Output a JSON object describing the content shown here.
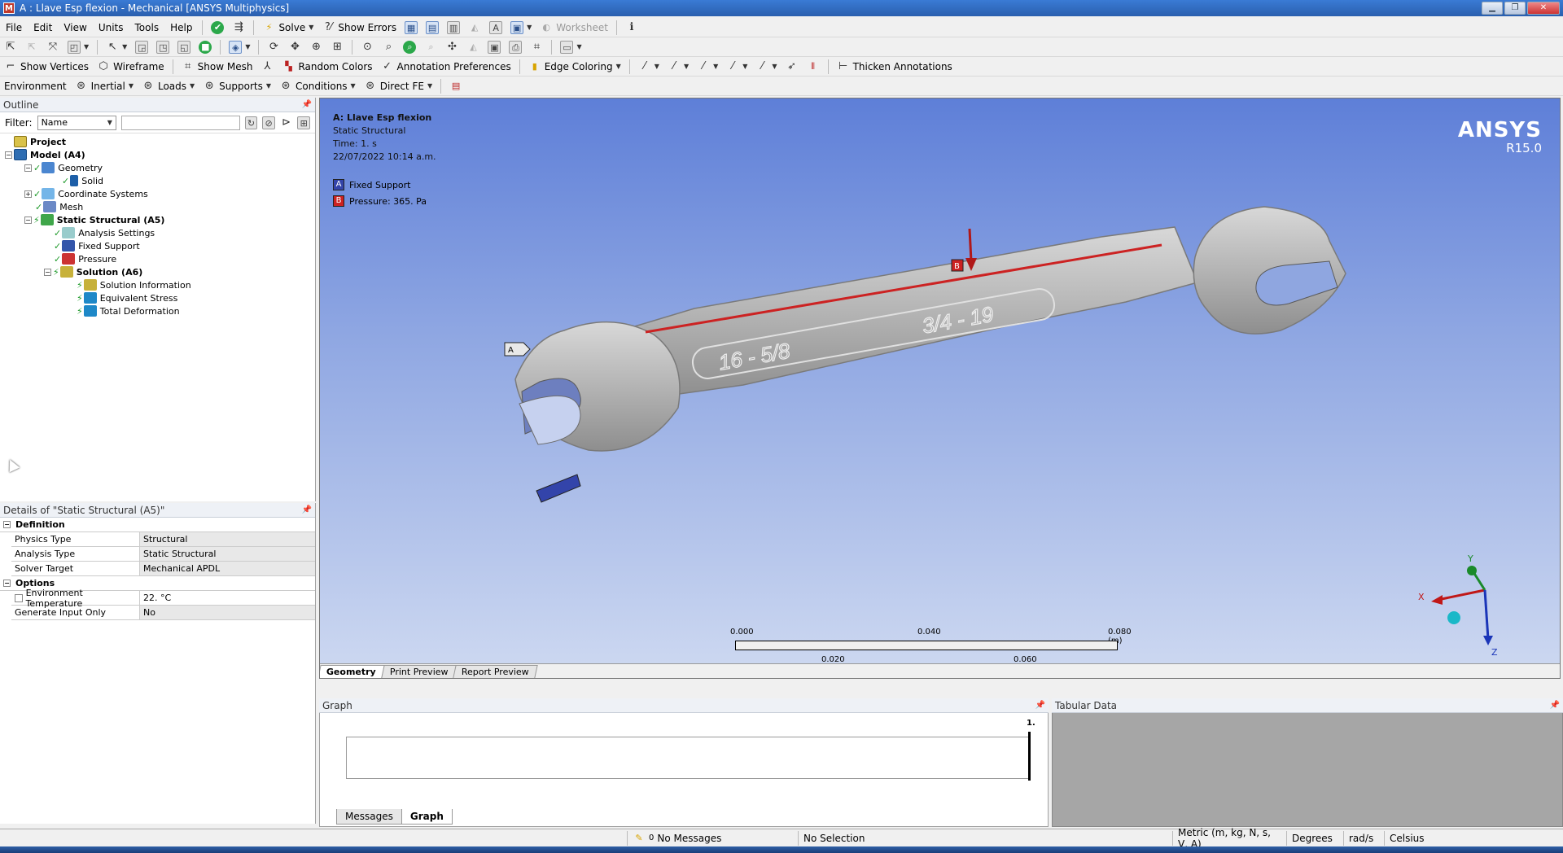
{
  "window": {
    "title": "A : Llave Esp flexion - Mechanical [ANSYS Multiphysics]",
    "app_icon_letter": "M"
  },
  "menubar": {
    "items": [
      "File",
      "Edit",
      "View",
      "Units",
      "Tools",
      "Help"
    ],
    "solve_label": "Solve",
    "show_errors_label": "Show Errors",
    "worksheet_label": "Worksheet"
  },
  "toolbar3": {
    "show_vertices": "Show Vertices",
    "wireframe": "Wireframe",
    "show_mesh": "Show Mesh",
    "random_colors": "Random Colors",
    "annotation_preferences": "Annotation Preferences",
    "edge_coloring": "Edge Coloring",
    "thicken_annotations": "Thicken Annotations"
  },
  "toolbar4": {
    "environment": "Environment",
    "inertial": "Inertial",
    "loads": "Loads",
    "supports": "Supports",
    "conditions": "Conditions",
    "direct_fe": "Direct FE"
  },
  "outline": {
    "header": "Outline",
    "filter_label": "Filter:",
    "filter_value": "Name",
    "tree": {
      "project": "Project",
      "model": "Model (A4)",
      "geometry": "Geometry",
      "solid": "Solid",
      "coordinate_systems": "Coordinate Systems",
      "mesh": "Mesh",
      "static_structural": "Static Structural (A5)",
      "analysis_settings": "Analysis Settings",
      "fixed_support": "Fixed Support",
      "pressure": "Pressure",
      "solution": "Solution (A6)",
      "solution_information": "Solution Information",
      "equivalent_stress": "Equivalent Stress",
      "total_deformation": "Total Deformation"
    }
  },
  "details": {
    "header": "Details of \"Static Structural (A5)\"",
    "definition_label": "Definition",
    "options_label": "Options",
    "physics_type_k": "Physics Type",
    "physics_type_v": "Structural",
    "analysis_type_k": "Analysis Type",
    "analysis_type_v": "Static Structural",
    "solver_target_k": "Solver Target",
    "solver_target_v": "Mechanical APDL",
    "env_temp_k": "Environment Temperature",
    "env_temp_v": "22. °C",
    "gen_input_k": "Generate Input Only",
    "gen_input_v": "No"
  },
  "viewport": {
    "info_title": "A: Llave Esp flexion",
    "info_type": "Static Structural",
    "info_time": "Time: 1. s",
    "info_date": "22/07/2022 10:14 a.m.",
    "legend_a_letter": "A",
    "legend_a": "Fixed Support",
    "legend_b_letter": "B",
    "legend_b": "Pressure: 365. Pa",
    "logo": "ANSYS",
    "version": "R15.0",
    "wrench_text_left": "16 - 5/8",
    "wrench_text_right": "3/4 - 19",
    "scale": {
      "t0": "0.000",
      "t1": "0.040",
      "t2": "0.080 (m)",
      "b1": "0.020",
      "b2": "0.060"
    },
    "axes": {
      "x": "X",
      "y": "Y",
      "z": "Z"
    },
    "tabs": [
      "Geometry",
      "Print Preview",
      "Report Preview"
    ]
  },
  "graph": {
    "header": "Graph",
    "marker": "1.",
    "tabs": [
      "Messages",
      "Graph"
    ]
  },
  "tabular": {
    "header": "Tabular Data"
  },
  "status": {
    "messages_count": "0",
    "messages": "No Messages",
    "selection": "No Selection",
    "units": "Metric (m, kg, N, s, V, A)",
    "angle": "Degrees",
    "rot": "rad/s",
    "temp": "Celsius"
  },
  "colors": {
    "fixed_support": "#3344aa",
    "pressure": "#cc2222",
    "viewport_top": "#5e7fd8",
    "viewport_bottom": "#ced9f1"
  }
}
